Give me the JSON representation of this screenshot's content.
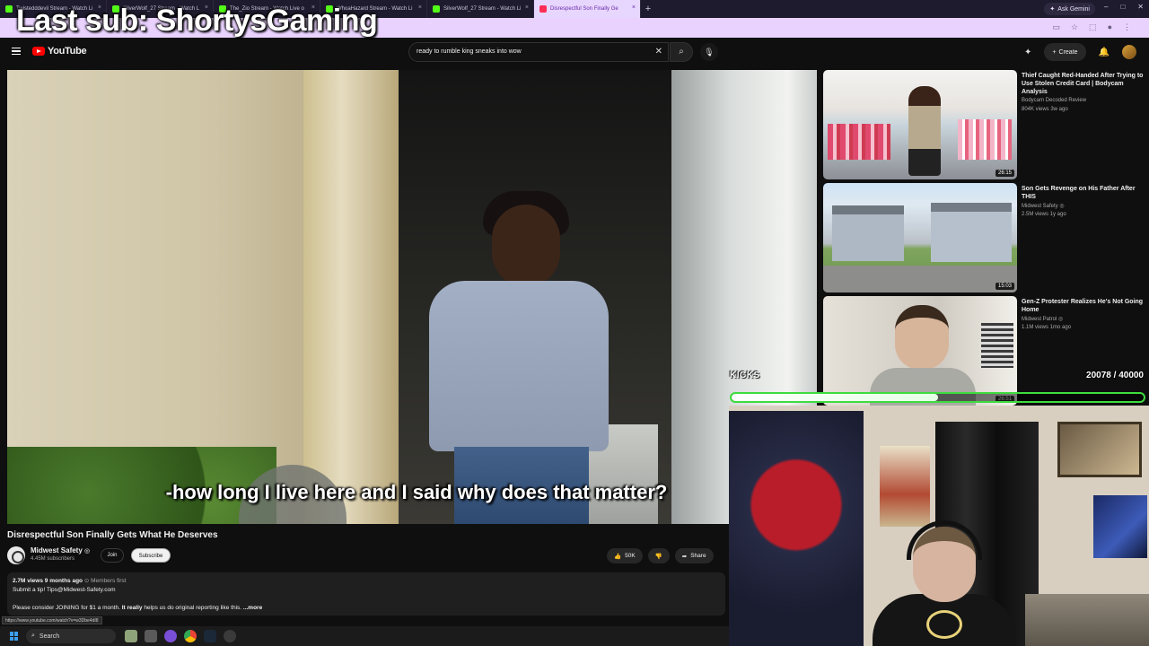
{
  "browser": {
    "tabs": [
      {
        "title": "Twistedddevil Stream - Watch Li",
        "active": false,
        "icon": "kick-favicon"
      },
      {
        "title": "SilverWolf_27 Stream - Watch L",
        "active": false,
        "icon": "kick-favicon"
      },
      {
        "title": "The_Zio Stream - Watch Live o",
        "active": false,
        "icon": "kick-favicon"
      },
      {
        "title": "WhoaHazard Stream - Watch Li",
        "active": false,
        "icon": "kick-favicon"
      },
      {
        "title": "SilverWolf_27 Stream - Watch Li",
        "active": false,
        "icon": "kick-favicon"
      },
      {
        "title": "Disrespectful Son Finally Ge",
        "active": true,
        "icon": "youtube-favicon"
      }
    ],
    "new_tab": "+",
    "close_glyph": "×",
    "ask_gemini": "Ask Gemini"
  },
  "overlay": {
    "last_sub": "Last sub: ShortysGaming",
    "kicks_label": "KICKS",
    "kicks_count": "20078 / 40000",
    "kicks_progress": 0.502
  },
  "youtube": {
    "logo_text": "YouTube",
    "search": {
      "query": "ready to rumble king sneaks into wow"
    },
    "create_label": "Create"
  },
  "video": {
    "caption": "-how long I live here and I said why does that matter?",
    "title": "Disrespectful Son Finally Gets What He Deserves",
    "channel": {
      "name": "Midwest Safety",
      "subscribers": "4.45M subscribers"
    },
    "join_label": "Join",
    "subscribe_label": "Subscribe",
    "likes": "50K",
    "share_label": "Share",
    "description": {
      "meta": "2.7M views  9 months ago",
      "members_tag": "Members first",
      "line1": "Submit a tip! Tips@Midwest-Safety.com",
      "line2_bold": "It really",
      "line2_pre": "Please consider JOINING for $1 a month. ",
      "line2_post": " helps us do original reporting like this.",
      "more": "...more"
    },
    "status_url": "https://www.youtube.com/watch?v=w3Dbe4dI8"
  },
  "recommendations": [
    {
      "title": "Thief Caught Red-Handed After Trying to Use Stolen Credit Card | Bodycam Analysis",
      "channel": "Bodycam Decoded Review",
      "meta": "804K views  3w ago",
      "duration": "26:15"
    },
    {
      "title": "Son Gets Revenge on His Father After THIS",
      "channel": "Midwest Safety",
      "meta": "2.5M views  1y ago",
      "duration": "15:03"
    },
    {
      "title": "Gen-Z Protester Realizes He's Not Going Home",
      "channel": "Midwest Patrol",
      "meta": "1.1M views  1mo ago",
      "duration": "26:51"
    }
  ],
  "taskbar": {
    "search_label": "Search"
  }
}
